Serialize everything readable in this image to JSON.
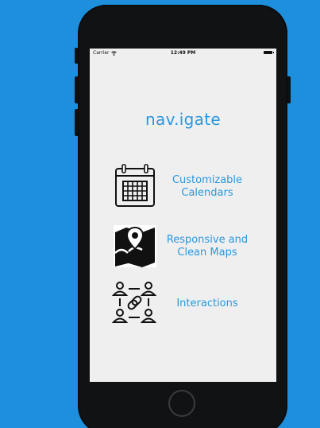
{
  "status_bar": {
    "carrier": "Carrier",
    "time": "12:49 PM",
    "wifi_icon": "wifi-icon",
    "battery_icon": "battery-icon"
  },
  "app": {
    "title": "nav.igate"
  },
  "features": [
    {
      "icon": "calendar-icon",
      "label_line1": "Customizable",
      "label_line2": "Calendars"
    },
    {
      "icon": "map-pin-icon",
      "label_line1": "Responsive and",
      "label_line2": "Clean Maps"
    },
    {
      "icon": "people-link-icon",
      "label_line1": "Interactions",
      "label_line2": ""
    }
  ],
  "colors": {
    "background": "#1d8fdc",
    "accent_text": "#2b98dd",
    "screen": "#efefef",
    "phone_body": "#111214"
  }
}
